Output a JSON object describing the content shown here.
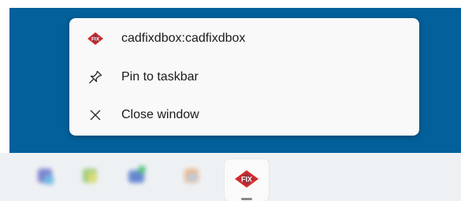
{
  "jump_list": {
    "app_title": "cadfixdbox:cadfixdbox",
    "pin_label": "Pin to taskbar",
    "close_label": "Close window"
  },
  "app_badge_text": "FIX",
  "colors": {
    "desktop": "#03609a",
    "badge_red": "#d32b2b",
    "badge_navy": "#1e3a6e"
  }
}
